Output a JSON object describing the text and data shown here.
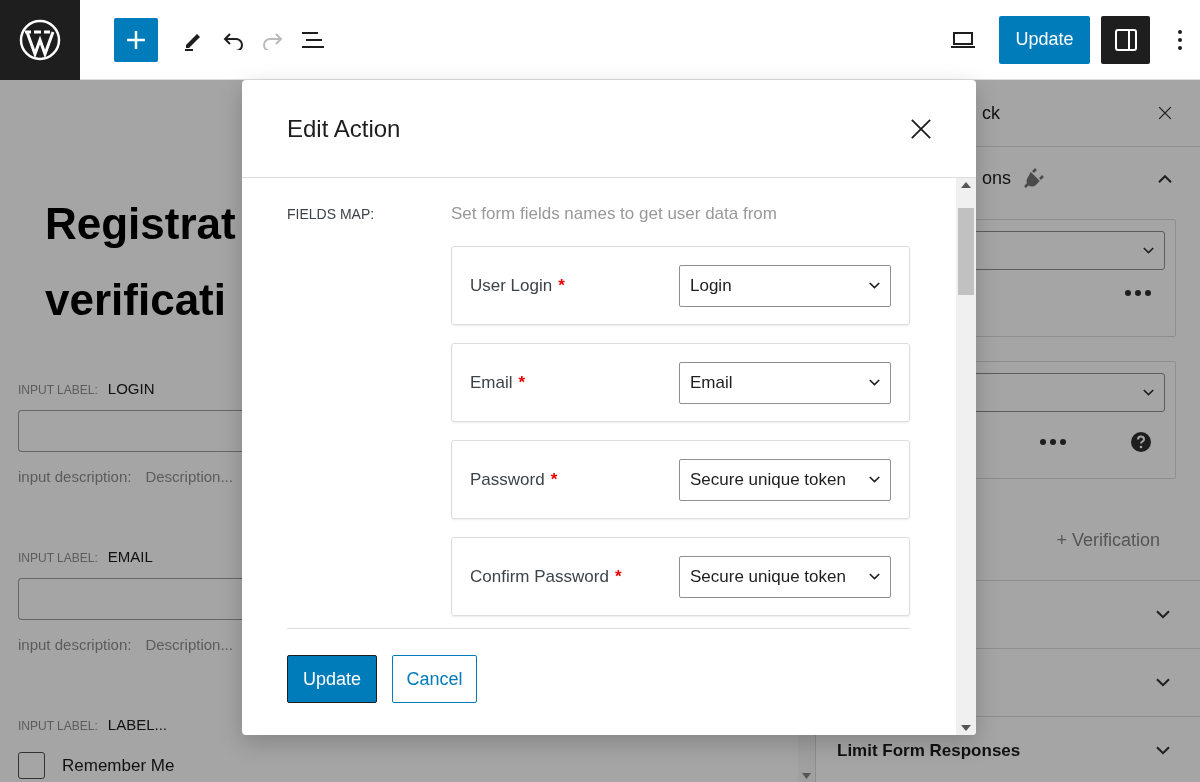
{
  "toolbar": {
    "undo": {
      "disabled": false
    },
    "redo": {
      "disabled": true
    },
    "update_button": "Update",
    "sidebar_toggle": {
      "on": true
    }
  },
  "editor": {
    "heading": [
      "Registrat",
      "verificati"
    ],
    "fields": [
      {
        "kind": "input",
        "label_caption": "INPUT LABEL:",
        "label": "LOGIN",
        "description_caption": "input description:",
        "description": "Description..."
      },
      {
        "kind": "input",
        "label_caption": "INPUT LABEL:",
        "label": "EMAIL",
        "description_caption": "input description:",
        "description": "Description..."
      },
      {
        "kind": "checkbox",
        "label_caption": "INPUT LABEL:",
        "label": "LABEL...",
        "option": "Remember Me",
        "checked": false
      }
    ]
  },
  "sidebar": {
    "tab": "ck",
    "section": {
      "title": "ons",
      "expanded": true
    },
    "cards": [
      {
        "kind": "plain"
      },
      {
        "kind": "help"
      }
    ],
    "add_link": "+ Verification",
    "accordions": [
      {
        "expanded": false
      },
      {
        "expanded": false
      },
      {
        "title": "Limit Form Responses",
        "expanded": false
      }
    ]
  },
  "modal": {
    "title": "Edit Action",
    "fields_map_label": "FIELDS MAP:",
    "hint": "Set form fields names to get user data from",
    "mappings": [
      {
        "label": "User Login",
        "required_mark": "*",
        "value": "Login"
      },
      {
        "label": "Email",
        "required_mark": "*",
        "value": "Email"
      },
      {
        "label": "Password",
        "required_mark": "*",
        "value": "Secure unique token"
      },
      {
        "label": "Confirm Password",
        "required_mark": "*",
        "value": "Secure unique token"
      }
    ],
    "update_button": "Update",
    "cancel_button": "Cancel"
  }
}
